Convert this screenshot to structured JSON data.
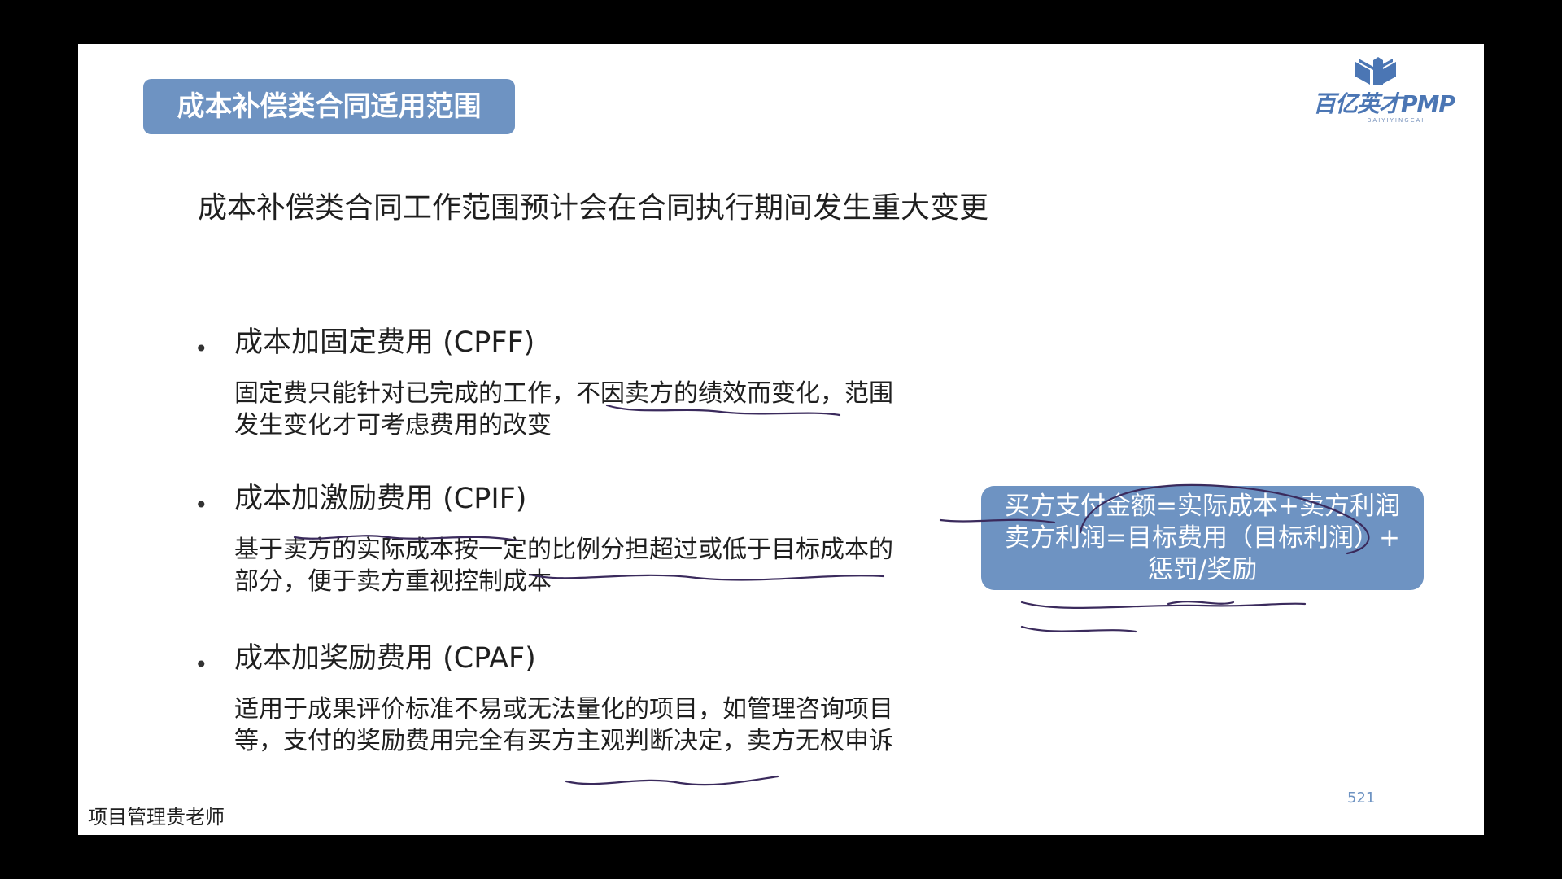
{
  "slide": {
    "title": "成本补偿类合同适用范围",
    "logo": {
      "text": "百亿英才PMP",
      "subtext": "BAIYIYINGCAI"
    },
    "intro": "成本补偿类合同工作范围预计会在合同执行期间发生重大变更",
    "bullet_symbol": "•",
    "items": [
      {
        "title": "成本加固定费用 (CPFF)",
        "desc_lines": [
          "固定费只能针对已完成的工作，不因卖方的绩效而变化，范围",
          "发生变化才可考虑费用的改变"
        ]
      },
      {
        "title": "成本加激励费用 (CPIF)",
        "desc_lines": [
          "基于卖方的实际成本按一定的比例分担超过或低于目标成本的",
          "部分，便于卖方重视控制成本"
        ]
      },
      {
        "title": "成本加奖励费用 (CPAF)",
        "desc_lines": [
          "适用于成果评价标准不易或无法量化的项目，如管理咨询项目",
          "等，支付的奖励费用完全有买方主观判断决定，卖方无权申诉"
        ]
      }
    ],
    "formula_lines": [
      "买方支付金额=实际成本+卖方利润",
      "卖方利润=目标费用（目标利润）+",
      "惩罚/奖励"
    ],
    "page_number": "521",
    "footer": "项目管理贵老师"
  },
  "colors": {
    "accent": "#6e93c2",
    "background": "#ffffff",
    "frame": "#000000",
    "ink": "#3a2a5c"
  }
}
